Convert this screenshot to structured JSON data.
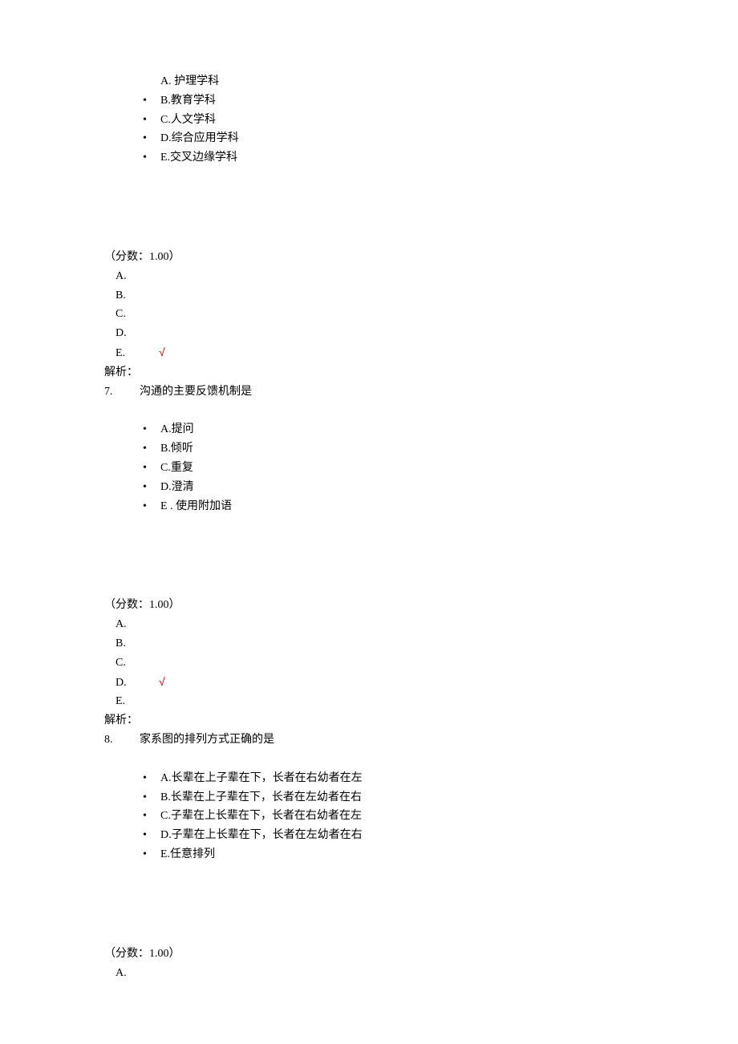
{
  "q6": {
    "options": [
      "A. 护理学科",
      "B.教育学科",
      "C.人文学科",
      "D.综合应用学科",
      "E.交叉边缘学科"
    ],
    "score": "（分数：1.00）",
    "labels": [
      "A.",
      "B.",
      "C.",
      "D.",
      "E."
    ],
    "check": "√",
    "analysis": "解析："
  },
  "q7": {
    "num": "7.",
    "text": "沟通的主要反馈机制是",
    "options": [
      "A.提问",
      "B.倾听",
      "C.重复",
      "D.澄清",
      "E . 使用附加语"
    ],
    "score": "（分数：1.00）",
    "labels": [
      "A.",
      "B.",
      "C.",
      "D.",
      "E."
    ],
    "check": "√",
    "analysis": "解析："
  },
  "q8": {
    "num": "8.",
    "text": "家系图的排列方式正确的是",
    "options": [
      "A.长辈在上子辈在下，长者在右幼者在左",
      "B.长辈在上子辈在下，长者在左幼者在右",
      "C.子辈在上长辈在下，长者在右幼者在左",
      "D.子辈在上长辈在下，长者在左幼者在右",
      "E.任意排列"
    ],
    "score": "（分数：1.00）",
    "labels": [
      "A."
    ]
  },
  "bullet": "•"
}
